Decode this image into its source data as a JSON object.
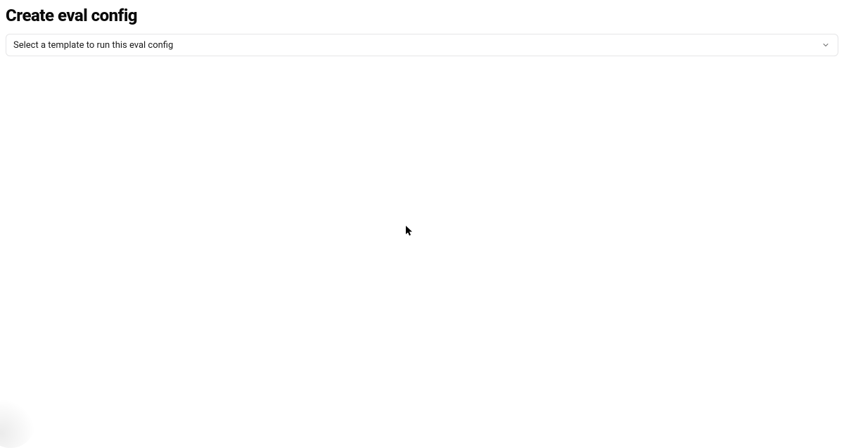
{
  "header": {
    "title": "Create eval config"
  },
  "template_select": {
    "placeholder": "Select a template to run this eval config"
  }
}
